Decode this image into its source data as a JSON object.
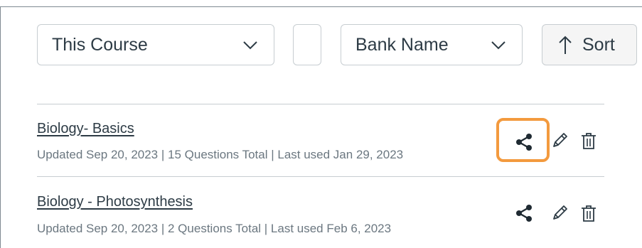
{
  "filters": {
    "course_select": "This Course",
    "bank_select": "Bank Name",
    "sort_label": "Sort"
  },
  "banks": [
    {
      "title": "Biology- Basics",
      "meta": "Updated Sep 20, 2023 | 15 Questions Total | Last used Jan 29, 2023",
      "share_highlighted": true
    },
    {
      "title": "Biology - Photosynthesis",
      "meta": "Updated Sep 20, 2023 | 2 Questions Total | Last used Feb 6, 2023",
      "share_highlighted": false
    }
  ],
  "colors": {
    "highlight": "#f39a3e",
    "text": "#2d3b45",
    "meta_text": "#6b7780",
    "border": "#c7cdd1"
  },
  "icons": [
    "chevron-down-icon",
    "arrow-up-icon",
    "share-icon",
    "pencil-icon",
    "trash-icon"
  ]
}
